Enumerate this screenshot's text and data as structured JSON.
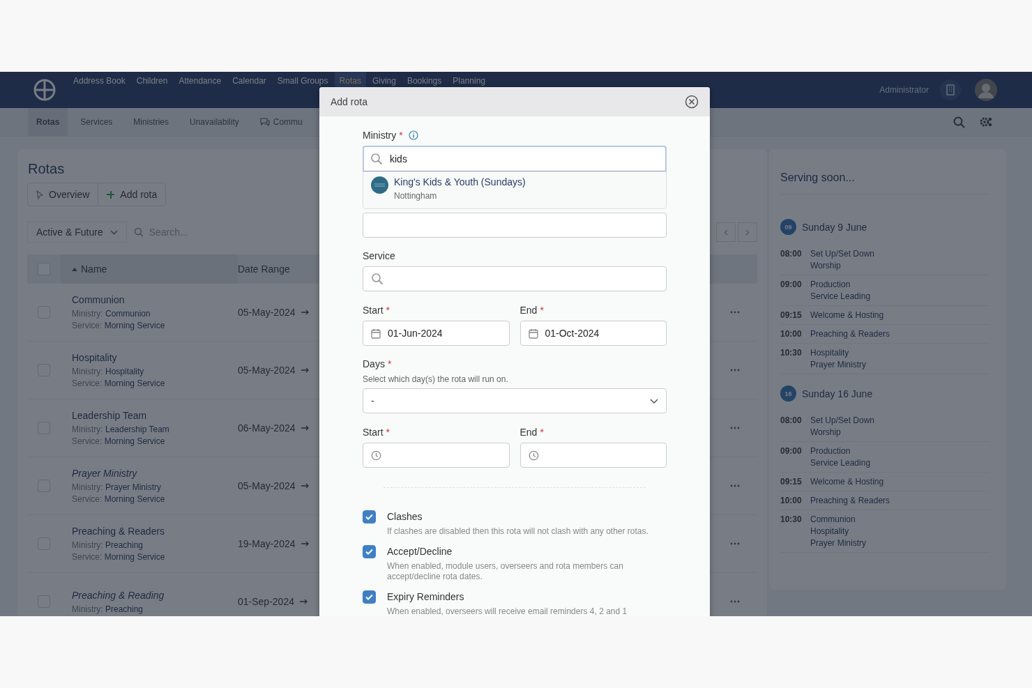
{
  "navbar": {
    "items": [
      {
        "label": "Address Book",
        "selected": false
      },
      {
        "label": "Children",
        "selected": false
      },
      {
        "label": "Attendance",
        "selected": false
      },
      {
        "label": "Calendar",
        "selected": false
      },
      {
        "label": "Small Groups",
        "selected": false
      },
      {
        "label": "Rotas",
        "selected": true
      },
      {
        "label": "Giving",
        "selected": false
      },
      {
        "label": "Bookings",
        "selected": false
      },
      {
        "label": "Planning",
        "selected": false
      }
    ],
    "user": "Administrator"
  },
  "table_header_checked": false,
  "subnav": {
    "tabs": [
      {
        "label": "Rotas",
        "selected": true
      },
      {
        "label": "Services",
        "selected": false
      },
      {
        "label": "Ministries",
        "selected": false
      },
      {
        "label": "Unavailability",
        "selected": false
      },
      {
        "label": "Commu",
        "selected": false
      }
    ]
  },
  "main": {
    "title": "Rotas",
    "buttons": [
      "Overview",
      "Add rota"
    ],
    "filter": "Active & Future",
    "search_placeholder": "Search...",
    "columns": [
      "Name",
      "Date Range"
    ],
    "rows": [
      {
        "checked": false,
        "name": "Communion",
        "italic": false,
        "ministry_label": "Ministry:",
        "ministry": "Communion",
        "service_label": "Service:",
        "service": "Morning Service",
        "date": "05-May-2024"
      },
      {
        "checked": false,
        "name": "Hospitality",
        "italic": false,
        "ministry_label": "Ministry:",
        "ministry": "Hospitality",
        "service_label": "Service:",
        "service": "Morning Service",
        "date": "05-May-2024"
      },
      {
        "checked": false,
        "name": "Leadership Team",
        "italic": false,
        "ministry_label": "Ministry:",
        "ministry": "Leadership Team",
        "service_label": "Service:",
        "service": "Morning Service",
        "date": "06-May-2024"
      },
      {
        "checked": false,
        "name": "Prayer Ministry",
        "italic": true,
        "ministry_label": "Ministry:",
        "ministry": "Prayer Ministry",
        "service_label": "Service:",
        "service": "Morning Service",
        "date": "05-May-2024"
      },
      {
        "checked": false,
        "name": "Preaching & Readers",
        "italic": false,
        "ministry_label": "Ministry:",
        "ministry": "Preaching",
        "service_label": "Service:",
        "service": "Morning Service",
        "date": "19-May-2024"
      },
      {
        "checked": false,
        "name": "Preaching & Reading",
        "italic": true,
        "ministry_label": "Ministry:",
        "ministry": "Preaching",
        "date": "01-Sep-2024"
      }
    ]
  },
  "serving_soon": {
    "title": "Serving soon...",
    "days": [
      {
        "badge": "09",
        "label": "Sunday 9 June",
        "slots": [
          {
            "time": "08:00",
            "roles": [
              "Set Up/Set Down",
              "Worship"
            ]
          },
          {
            "time": "09:00",
            "roles": [
              "Production",
              "Service Leading"
            ]
          },
          {
            "time": "09:15",
            "roles": [
              "Welcome & Hosting"
            ]
          },
          {
            "time": "10:00",
            "roles": [
              "Preaching & Readers"
            ]
          },
          {
            "time": "10:30",
            "roles": [
              "Hospitality",
              "Prayer Ministry"
            ]
          }
        ]
      },
      {
        "badge": "16",
        "label": "Sunday 16 June",
        "slots": [
          {
            "time": "08:00",
            "roles": [
              "Set Up/Set Down",
              "Worship"
            ]
          },
          {
            "time": "09:00",
            "roles": [
              "Production",
              "Service Leading"
            ]
          },
          {
            "time": "09:15",
            "roles": [
              "Welcome & Hosting"
            ]
          },
          {
            "time": "10:00",
            "roles": [
              "Preaching & Readers"
            ]
          },
          {
            "time": "10:30",
            "roles": [
              "Communion",
              "Hospitality",
              "Prayer Ministry"
            ]
          }
        ]
      }
    ]
  },
  "modal": {
    "title": "Add rota",
    "ministry": {
      "label": "Ministry",
      "required_mark": "*",
      "value": "kids",
      "option": {
        "name": "King's Kids & Youth (Sundays)",
        "location": "Nottingham"
      }
    },
    "service": {
      "label": "Service"
    },
    "dates": [
      {
        "label": "Start",
        "required_mark": "*",
        "value": "01-Jun-2024"
      },
      {
        "label": "End",
        "required_mark": "*",
        "value": "01-Oct-2024"
      }
    ],
    "days": {
      "label": "Days",
      "required_mark": "*",
      "hint": "Select which day(s) the rota will run on.",
      "value": "-"
    },
    "times": [
      {
        "label": "Start",
        "required_mark": "*"
      },
      {
        "label": "End",
        "required_mark": "*"
      }
    ],
    "options": [
      {
        "label": "Clashes",
        "checked": true,
        "description": "If clashes are disabled then this rota will not clash with any other rotas."
      },
      {
        "label": "Accept/Decline",
        "checked": true,
        "description": "When enabled, module users, overseers and rota members can accept/decline rota dates."
      },
      {
        "label": "Expiry Reminders",
        "checked": true,
        "description": "When enabled, overseers will receive email reminders 4, 2 and 1"
      }
    ]
  }
}
